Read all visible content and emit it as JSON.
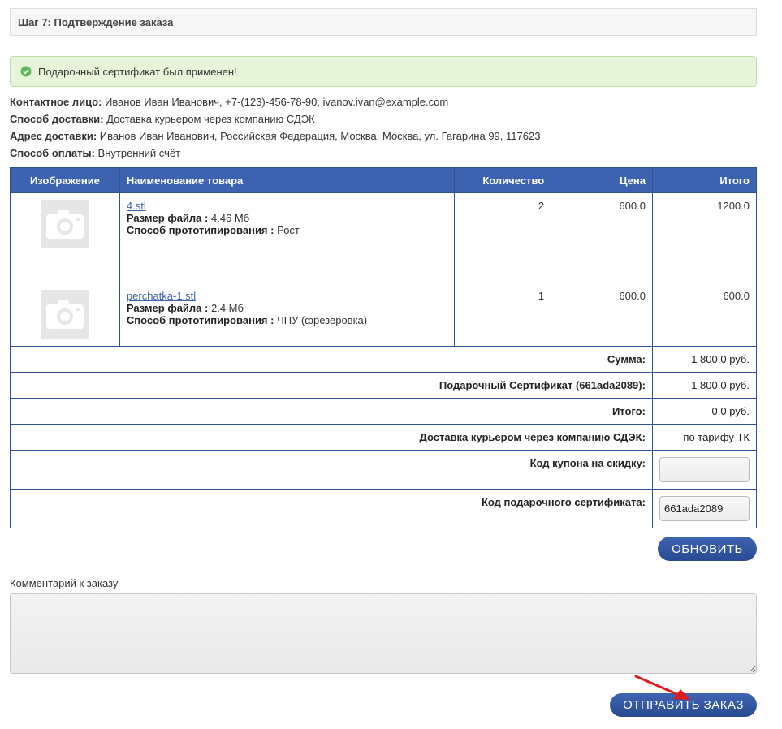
{
  "step": {
    "title": "Шаг 7: Подтверждение заказа"
  },
  "alert": {
    "text": "Подарочный сертификат был применен!"
  },
  "info": {
    "contact_label": "Контактное лицо:",
    "contact_value": "Иванов Иван Иванович, +7-(123)-456-78-90, ivanov.ivan@example.com",
    "delivery_label": "Способ доставки:",
    "delivery_value": "Доставка курьером через компанию СДЭК",
    "address_label": "Адрес доставки:",
    "address_value": "Иванов Иван Иванович, Российская Федерация, Москва, Москва, ул. Гагарина 99, 117623",
    "payment_label": "Способ оплаты:",
    "payment_value": "Внутренний счёт"
  },
  "table": {
    "headers": {
      "image": "Изображение",
      "name": "Наименование товара",
      "qty": "Количество",
      "price": "Цена",
      "total": "Итого"
    },
    "rows": [
      {
        "name": "4.stl",
        "size_label": "Размер файла :",
        "size_value": "4.46 Мб",
        "method_label": "Способ прототипирования :",
        "method_value": "Рост",
        "qty": "2",
        "price": "600.0",
        "total": "1200.0"
      },
      {
        "name": "perchatka-1.stl",
        "size_label": "Размер файла :",
        "size_value": "2.4 Мб",
        "method_label": "Способ прототипирования :",
        "method_value": "ЧПУ (фрезеровка)",
        "qty": "1",
        "price": "600.0",
        "total": "600.0"
      }
    ],
    "summary": {
      "sum_label": "Сумма:",
      "sum_value": "1 800.0 руб.",
      "cert_label": "Подарочный Сертификат (661ada2089):",
      "cert_value": "-1 800.0 руб.",
      "total_label": "Итого:",
      "total_value": "0.0 руб.",
      "delivery_label": "Доставка курьером через компанию СДЭК:",
      "delivery_value": "по тарифу ТК",
      "coupon_label": "Код купона на скидку:",
      "coupon_value": "",
      "giftcode_label": "Код подарочного сертификата:",
      "giftcode_value": "661ada2089"
    }
  },
  "buttons": {
    "update": "ОБНОВИТЬ",
    "submit": "ОТПРАВИТЬ ЗАКАЗ"
  },
  "comment": {
    "label": "Комментарий к заказу",
    "value": ""
  },
  "icons": {
    "check": "check-circle-icon",
    "photo": "camera-placeholder-icon",
    "arrow": "red-arrow-annotation"
  },
  "colors": {
    "primary": "#3d62b0",
    "alert_bg": "#e6f5d9",
    "alert_border": "#bfe0a9",
    "arrow": "#e0191b"
  }
}
